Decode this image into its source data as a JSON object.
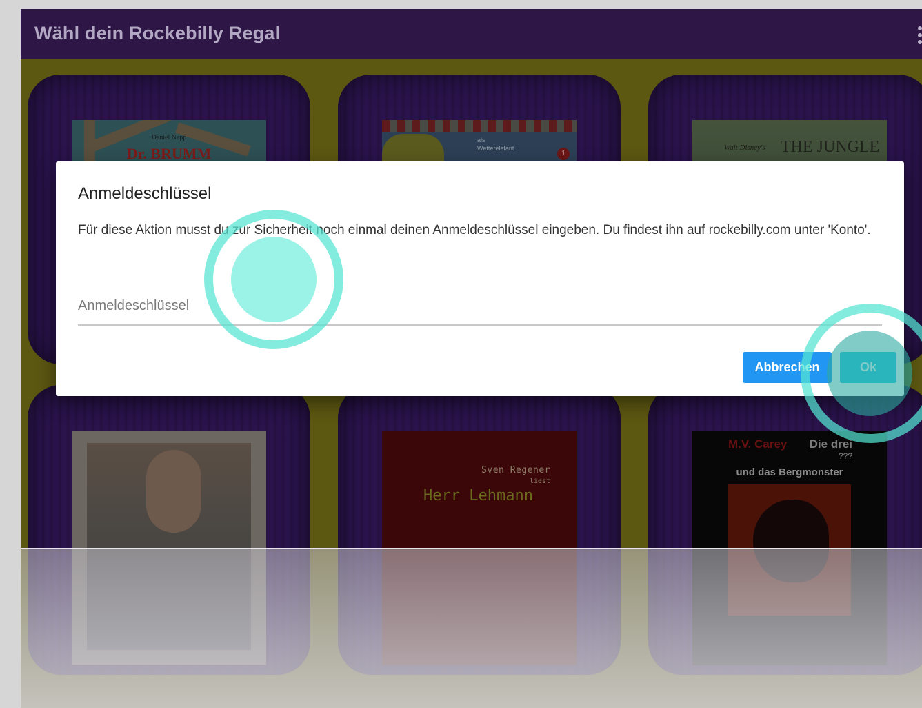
{
  "app": {
    "title": "Wähl dein Rockebilly Regal"
  },
  "shelf": {
    "covers": [
      {
        "author": "Daniel Napp",
        "title": "Dr. BRUMM"
      },
      {
        "text_a": "als",
        "text_b": "Wetterelefant",
        "badge": "1"
      },
      {
        "brand": "Walt Disney's",
        "title": "THE JUNGLE"
      },
      {
        "title": ""
      },
      {
        "reader": "Sven Regener",
        "reader_note": "liest",
        "title": "Herr Lehmann"
      },
      {
        "author": "M.V. Carey",
        "series": "Die drei",
        "series_mark": "???",
        "title": "und das Bergmonster"
      }
    ]
  },
  "dialog": {
    "title": "Anmeldeschlüssel",
    "message": "Für diese Aktion musst du zur Sicherheit noch einmal deinen Anmeldeschlüssel eingeben. Du findest ihn auf rockebilly.com unter 'Konto'.",
    "field": {
      "placeholder": "Anmeldeschlüssel",
      "value": ""
    },
    "cancel_label": "Abbrechen",
    "ok_label": "Ok"
  },
  "colors": {
    "toolbar": "#2e1646",
    "cancel_button": "#2196f3",
    "ok_button": "#27c4e7",
    "touch_indicator": "#55e4d3"
  }
}
